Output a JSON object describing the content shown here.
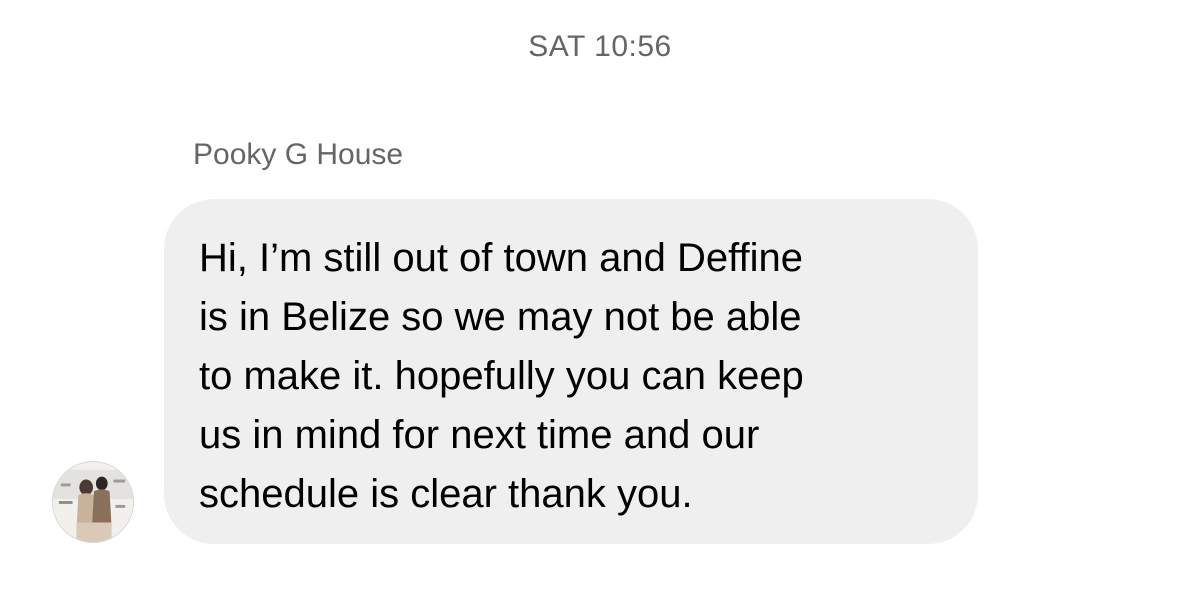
{
  "conversation": {
    "timestamp": "SAT 10:56",
    "sender": {
      "name": "Pooky G House",
      "avatar_icon": "profile-photo"
    },
    "message": {
      "text": "Hi, I’m still out of town and Deffine\nis in Belize so we may not be able\nto make it. hopefully you can keep\nus in mind for next time and our\nschedule is clear thank you."
    }
  },
  "colors": {
    "background": "#ffffff",
    "bubble": "#efefef",
    "meta_text": "#656565",
    "message_text": "#000000"
  }
}
